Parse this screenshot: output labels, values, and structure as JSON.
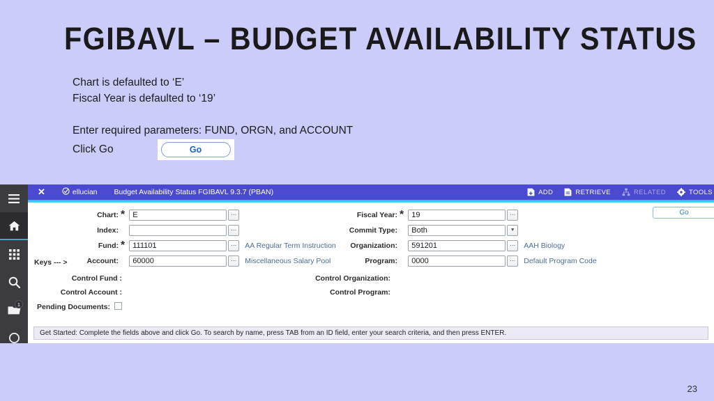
{
  "slide": {
    "title": "FGIBAVL  –  BUDGET AVAILABILITY STATUS",
    "lines": [
      "Chart is defaulted to ‘E’",
      "Fiscal Year is defaulted to ‘19’"
    ],
    "instruction": "Enter required parameters:  FUND, ORGN, and ACCOUNT",
    "click_go_label": "Click Go",
    "go_button_label": "Go",
    "page_number": "23",
    "background_color": "#ccccfa"
  },
  "app": {
    "header": {
      "close_icon": "close-icon",
      "brand": "ellucian",
      "title": "Budget Availability Status FGIBAVL 9.3.7 (PBAN)",
      "accent_color": "#4b49cf",
      "actions": [
        {
          "label": "ADD",
          "icon": "add-document-icon",
          "disabled": false
        },
        {
          "label": "RETRIEVE",
          "icon": "retrieve-document-icon",
          "disabled": false
        },
        {
          "label": "RELATED",
          "icon": "related-icon",
          "disabled": true
        },
        {
          "label": "TOOLS",
          "icon": "gear-icon",
          "disabled": false
        }
      ]
    },
    "sidebar": {
      "items": [
        {
          "name": "menu-icon",
          "badge": ""
        },
        {
          "name": "home-icon",
          "badge": "",
          "active": true
        },
        {
          "name": "apps-grid-icon",
          "badge": ""
        },
        {
          "name": "search-icon",
          "badge": ""
        },
        {
          "name": "folder-icon",
          "badge": "1"
        },
        {
          "name": "help-icon",
          "badge": ""
        }
      ]
    },
    "go_button_label": "Go",
    "form": {
      "left": [
        {
          "label": "Chart:",
          "required": true,
          "value": "E",
          "desc": "",
          "control": "search"
        },
        {
          "label": "Index:",
          "required": false,
          "value": "",
          "desc": "",
          "control": "search"
        },
        {
          "label": "Fund:",
          "required": true,
          "value": "111101",
          "desc": "AA Regular Term Instruction",
          "control": "search"
        },
        {
          "label": "Account:",
          "required": false,
          "value": "60000",
          "desc": "Miscellaneous Salary Pool",
          "control": "search"
        }
      ],
      "right": [
        {
          "label": "Fiscal Year:",
          "required": true,
          "value": "19",
          "desc": "",
          "control": "search"
        },
        {
          "label": "Commit Type:",
          "required": false,
          "value": "Both",
          "desc": "",
          "control": "dropdown"
        },
        {
          "label": "Organization:",
          "required": false,
          "value": "591201",
          "desc": "AAH Biology",
          "control": "search"
        },
        {
          "label": "Program:",
          "required": false,
          "value": "0000",
          "desc": "Default Program Code",
          "control": "search"
        }
      ]
    },
    "keys": {
      "label": "Keys --- >",
      "control_fund": "Control Fund :",
      "control_account": "Control Account :",
      "pending_documents": "Pending Documents:",
      "control_organization": "Control Organization:",
      "control_program": "Control Program:"
    },
    "status_bar": "Get Started: Complete the fields above and click Go. To search by name, press TAB from an ID field, enter your search criteria, and then press ENTER."
  }
}
